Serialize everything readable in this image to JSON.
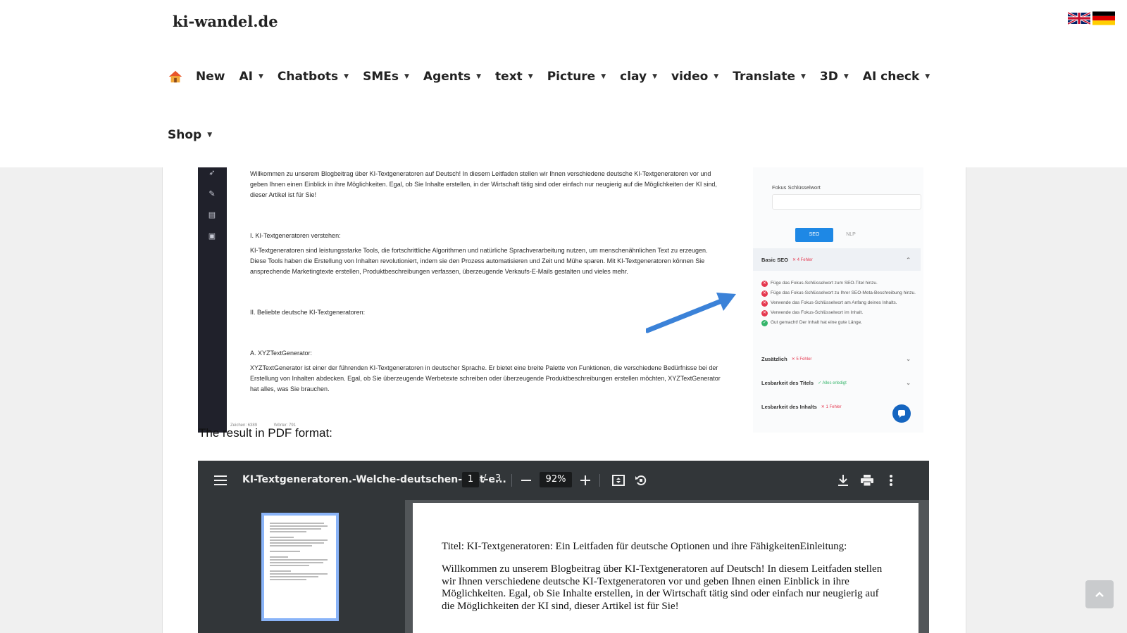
{
  "site": {
    "title": "ki-wandel.de",
    "flags": [
      "uk-flag-icon",
      "de-flag-icon"
    ]
  },
  "nav": {
    "items": [
      {
        "label": "New",
        "has_dropdown": false
      },
      {
        "label": "AI",
        "has_dropdown": true
      },
      {
        "label": "Chatbots",
        "has_dropdown": true
      },
      {
        "label": "SMEs",
        "has_dropdown": true
      },
      {
        "label": "Agents",
        "has_dropdown": true
      },
      {
        "label": "text",
        "has_dropdown": true
      },
      {
        "label": "Picture",
        "has_dropdown": true
      },
      {
        "label": "clay",
        "has_dropdown": true
      },
      {
        "label": "video",
        "has_dropdown": true
      },
      {
        "label": "Translate",
        "has_dropdown": true
      },
      {
        "label": "3D",
        "has_dropdown": true
      },
      {
        "label": "AI check",
        "has_dropdown": true
      },
      {
        "label": "Shop",
        "has_dropdown": true
      }
    ]
  },
  "screenshot": {
    "intro": "Willkommen zu unserem Blogbeitrag über KI-Textgeneratoren auf Deutsch! In diesem Leitfaden stellen wir Ihnen verschiedene deutsche KI-Textgeneratoren vor und geben Ihnen einen Einblick in ihre Möglichkeiten. Egal, ob Sie Inhalte erstellen, in der Wirtschaft tätig sind oder einfach nur neugierig auf die Möglichkeiten der KI sind, dieser Artikel ist für Sie!",
    "h1": "I. KI-Textgeneratoren verstehen:",
    "p1": "KI-Textgeneratoren sind leistungsstarke Tools, die fortschrittliche Algorithmen und natürliche Sprachverarbeitung nutzen, um menschenähnlichen Text zu erzeugen. Diese Tools haben die Erstellung von Inhalten revolutioniert, indem sie den Prozess automatisieren und Zeit und Mühe sparen. Mit KI-Textgeneratoren können Sie ansprechende Marketingtexte erstellen, Produktbeschreibungen verfassen, überzeugende Verkaufs-E-Mails gestalten und vieles mehr.",
    "h2": "II. Beliebte deutsche KI-Textgeneratoren:",
    "h3": "A. XYZTextGenerator:",
    "p3": "XYZTextGenerator ist einer der führenden KI-Textgeneratoren in deutscher Sprache. Er bietet eine breite Palette von Funktionen, die verschiedene Bedürfnisse bei der Erstellung von Inhalten abdecken. Egal, ob Sie überzeugende Werbetexte schreiben oder überzeugende Produktbeschreibungen erstellen möchten, XYZTextGenerator hat alles, was Sie brauchen.",
    "footer_chars": "Zeichen: 6389",
    "footer_words": "Wörter: 791",
    "seo": {
      "focus_label": "Fokus Schlüsselwort",
      "tab_seo": "SEO",
      "tab_nlp": "NLP",
      "basic_seo": "Basic SEO",
      "basic_seo_badge": "4 Fehler",
      "checks": [
        {
          "status": "bad",
          "text": "Füge das Fokus-Schlüsselwort zum SEO-Titel hinzu."
        },
        {
          "status": "bad",
          "text": "Füge das Fokus-Schlüsselwort zu Ihrer SEO-Meta-Beschreibung hinzu."
        },
        {
          "status": "bad",
          "text": "Verwende das Fokus-Schlüsselwort am Anfang deines Inhalts."
        },
        {
          "status": "bad",
          "text": "Verwende das Fokus-Schlüsselwort im Inhalt."
        },
        {
          "status": "good",
          "text": "Gut gemacht! Der Inhalt hat eine gute Länge."
        }
      ],
      "additional": "Zusätzlich",
      "additional_badge": "5 Fehler",
      "title_readability": "Lesbarkeit des Titels",
      "title_readability_badge": "Alles erledigt",
      "content_readability": "Lesbarkeit des Inhalts",
      "content_readability_badge": "1 Fehler"
    }
  },
  "result_caption": "The result in PDF format:",
  "pdf": {
    "filename": "KI-Textgeneratoren.-Welche-deutschen-gibt-e...",
    "current_page": "1",
    "page_separator": "/",
    "total_pages": "3",
    "zoom": "92%",
    "page_title_line": "Titel: KI-Textgeneratoren: Ein Leitfaden für deutsche Optionen und ihre FähigkeitenEinleitung:",
    "page_paragraph": "Willkommen zu unserem Blogbeitrag über KI-Textgeneratoren auf Deutsch! In diesem Leitfaden stellen wir Ihnen verschiedene deutsche KI-Textgeneratoren vor und geben Ihnen einen Einblick in ihre Möglichkeiten. Egal, ob Sie Inhalte erstellen, in der Wirtschaft tätig sind oder einfach nur neugierig auf die Möglichkeiten der KI sind, dieser Artikel ist für Sie!"
  },
  "colors": {
    "pdf_toolbar": "#323639",
    "seo_active_tab": "#1e88e5",
    "error_red": "#e53950",
    "success_green": "#35b56b",
    "arrow_blue": "#3b82d8"
  }
}
